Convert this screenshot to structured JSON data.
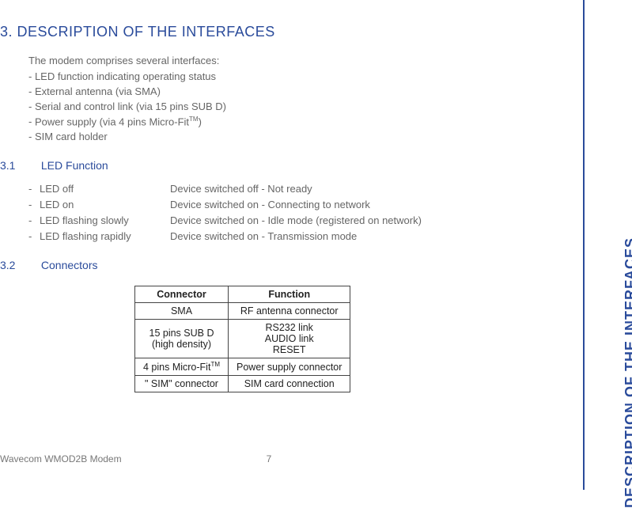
{
  "side_label": "DESCRIPTION OF THE INTERFACES",
  "h1": "3. DESCRIPTION OF THE INTERFACES",
  "intro": "The modem comprises several interfaces:",
  "bullets": [
    "LED function indicating operating status",
    "External antenna (via SMA)",
    "Serial and control link (via 15 pins SUB D)",
    "Power supply (via 4 pins Micro-Fit™)",
    "SIM card holder"
  ],
  "sec31_num": "3.1",
  "sec31_title": "LED Function",
  "led": [
    {
      "state": "LED off",
      "desc": "Device switched off - Not ready"
    },
    {
      "state": "LED on",
      "desc": "Device switched on - Connecting to network"
    },
    {
      "state": "LED flashing slowly",
      "desc": "Device switched on - Idle mode (registered on network)"
    },
    {
      "state": "LED flashing rapidly",
      "desc": "Device switched on - Transmission mode"
    }
  ],
  "sec32_num": "3.2",
  "sec32_title": "Connectors",
  "table": {
    "h1": "Connector",
    "h2": "Function",
    "rows": [
      {
        "c": "SMA",
        "f": "RF antenna connector"
      },
      {
        "c": "15 pins SUB D\n(high density)",
        "f": "RS232 link\nAUDIO link\nRESET"
      },
      {
        "c": "4 pins Micro-Fit™",
        "f": "Power supply connector"
      },
      {
        "c": "\" SIM\" connector",
        "f": "SIM card connection"
      }
    ]
  },
  "footer_title": "Wavecom WMOD2B Modem",
  "footer_page": "7"
}
